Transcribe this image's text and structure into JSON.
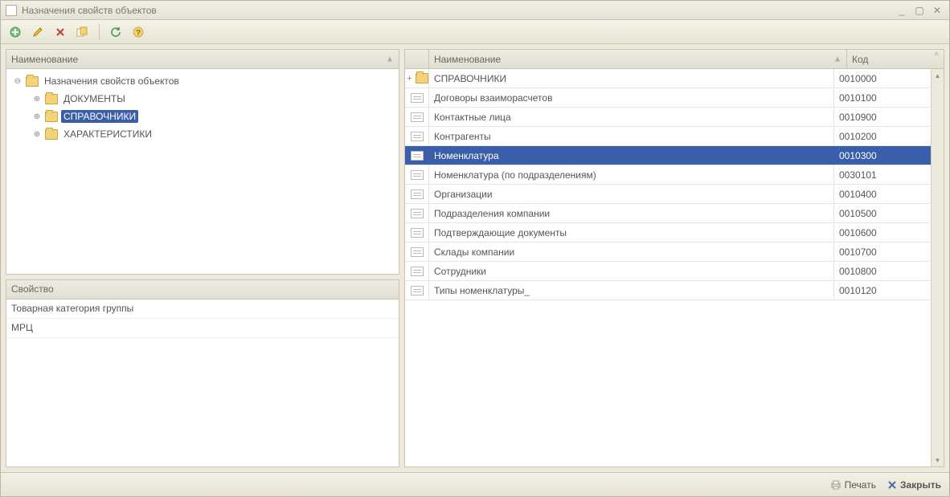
{
  "window": {
    "title": "Назначения свойств объектов"
  },
  "toolbar": {
    "add": "add",
    "edit": "edit",
    "delete": "delete",
    "copy": "copy",
    "refresh": "refresh",
    "help": "help"
  },
  "left": {
    "header_name": "Наименование",
    "tree": {
      "root_label": "Назначения свойств объектов",
      "items": [
        {
          "label": "ДОКУМЕНТЫ",
          "selected": false
        },
        {
          "label": "СПРАВОЧНИКИ",
          "selected": true
        },
        {
          "label": "ХАРАКТЕРИСТИКИ",
          "selected": false
        }
      ]
    },
    "props_header": "Свойство",
    "props": [
      {
        "label": "Товарная категория группы"
      },
      {
        "label": "МРЦ"
      }
    ]
  },
  "right": {
    "header_name": "Наименование",
    "header_code": "Код",
    "rows": [
      {
        "type": "folder",
        "marker": "+",
        "name": "СПРАВОЧНИКИ",
        "code": "0010000",
        "selected": false
      },
      {
        "type": "item",
        "name": "Договоры взаиморасчетов",
        "code": "0010100",
        "selected": false
      },
      {
        "type": "item",
        "name": "Контактные лица",
        "code": "0010900",
        "selected": false
      },
      {
        "type": "item",
        "name": "Контрагенты",
        "code": "0010200",
        "selected": false
      },
      {
        "type": "item",
        "name": "Номенклатура",
        "code": "0010300",
        "selected": true
      },
      {
        "type": "item",
        "name": "Номенклатура (по подразделениям)",
        "code": "0030101",
        "selected": false
      },
      {
        "type": "item",
        "name": "Организации",
        "code": "0010400",
        "selected": false
      },
      {
        "type": "item",
        "name": "Подразделения компании",
        "code": "0010500",
        "selected": false
      },
      {
        "type": "item",
        "name": "Подтверждающие документы",
        "code": "0010600",
        "selected": false
      },
      {
        "type": "item",
        "name": "Склады компании",
        "code": "0010700",
        "selected": false
      },
      {
        "type": "item",
        "name": "Сотрудники",
        "code": "0010800",
        "selected": false
      },
      {
        "type": "item",
        "name": "Типы номенклатуры_",
        "code": "0010120",
        "selected": false
      }
    ]
  },
  "footer": {
    "print_label": "Печать",
    "close_label": "Закрыть"
  }
}
